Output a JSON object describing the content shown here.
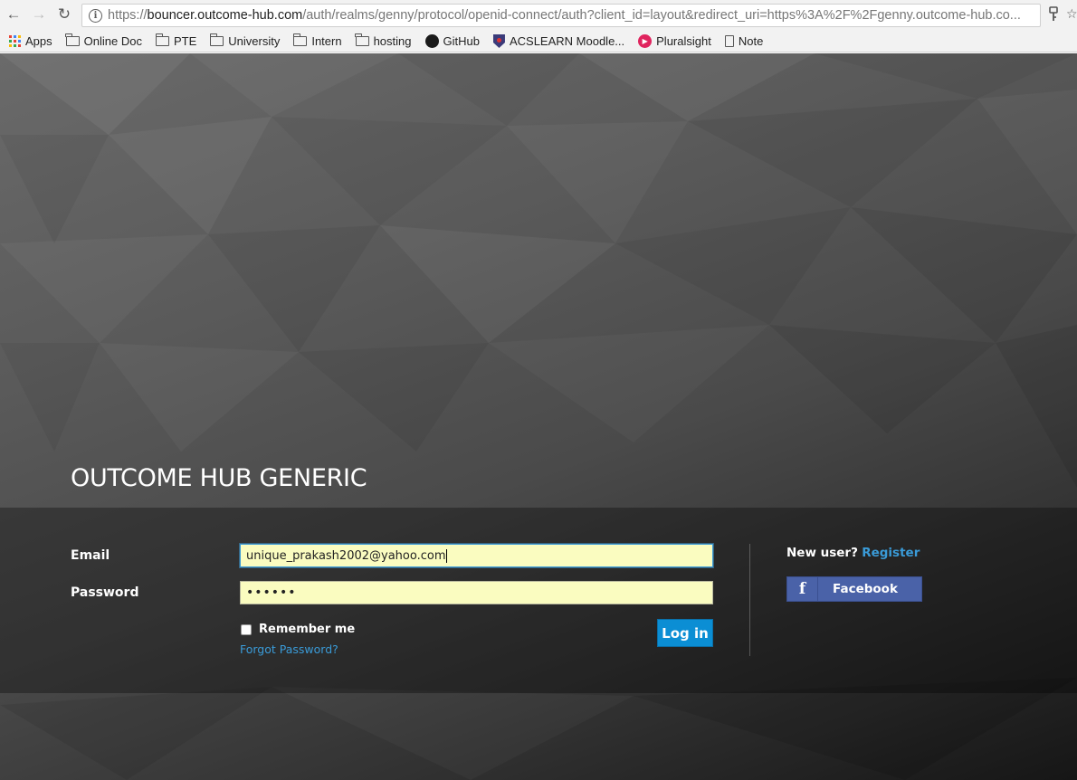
{
  "browser": {
    "url_scheme": "https://",
    "url_host": "bouncer.outcome-hub.com",
    "url_path": "/auth/realms/genny/protocol/openid-connect/auth?client_id=layout&redirect_uri=https%3A%2F%2Fgenny.outcome-hub.co...",
    "back_icon": "←",
    "forward_icon": "→",
    "reload_icon": "↻",
    "star_icon": "☆"
  },
  "bookmarks": [
    {
      "label": "Apps",
      "icon": "apps-grid-icon"
    },
    {
      "label": "Online Doc",
      "icon": "folder-icon"
    },
    {
      "label": "PTE",
      "icon": "folder-icon"
    },
    {
      "label": "University",
      "icon": "folder-icon"
    },
    {
      "label": "Intern",
      "icon": "folder-icon"
    },
    {
      "label": "hosting",
      "icon": "folder-icon"
    },
    {
      "label": "GitHub",
      "icon": "github-icon"
    },
    {
      "label": "ACSLEARN Moodle...",
      "icon": "acslearn-icon"
    },
    {
      "label": "Pluralsight",
      "icon": "pluralsight-icon"
    },
    {
      "label": "Note",
      "icon": "document-icon"
    }
  ],
  "login": {
    "realm_title": "OUTCOME HUB GENERIC",
    "email_label": "Email",
    "email_value": "unique_prakash2002@yahoo.com",
    "password_label": "Password",
    "password_mask": "••••••",
    "remember_label": "Remember me",
    "forgot_label": "Forgot Password?",
    "login_label": "Log in",
    "new_user_label": "New user?",
    "register_label": "Register",
    "facebook_label": "Facebook",
    "facebook_glyph": "f"
  },
  "colors": {
    "link": "#3a9bd8",
    "primary_button": "#0b8ed4",
    "facebook": "#4a62a8",
    "autofill": "#fafcc0"
  }
}
